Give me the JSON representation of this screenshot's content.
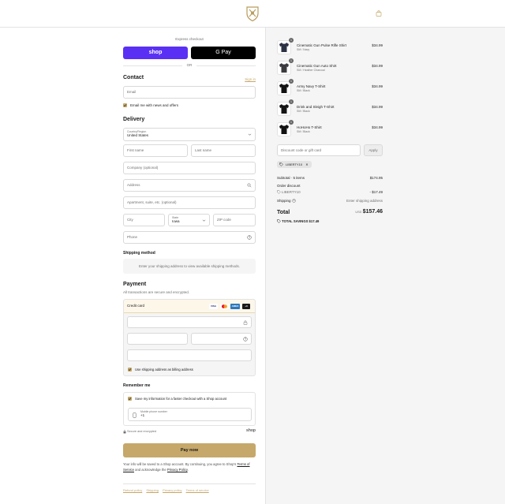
{
  "header": {
    "logo_icon": "shield-crest-icon",
    "cart_icon": "shopping-bag-icon"
  },
  "express": {
    "title": "Express checkout",
    "shop_label": "shop",
    "gpay_label": "G Pay",
    "or_label": "OR"
  },
  "contact": {
    "heading": "Contact",
    "sign_in": "Sign in",
    "email_placeholder": "Email",
    "news_label": "Email me with news and offers"
  },
  "delivery": {
    "heading": "Delivery",
    "country_label": "Country/Region",
    "country_value": "United States",
    "first_name": "First name",
    "last_name": "Last name",
    "company": "Company (optional)",
    "address": "Address",
    "apartment": "Apartment, suite, etc. (optional)",
    "city": "City",
    "state_label": "State",
    "state_value": "Iowa",
    "zip": "ZIP code",
    "phone": "Phone"
  },
  "shipping": {
    "heading": "Shipping method",
    "message": "Enter your shipping address to view available shipping methods."
  },
  "payment": {
    "heading": "Payment",
    "subtitle": "All transactions are secure and encrypted.",
    "method_label": "Credit card",
    "cards": [
      "VISA",
      "MC",
      "AMEX",
      "+3"
    ],
    "billing_label": "Use shipping address as billing address"
  },
  "remember": {
    "heading": "Remember me",
    "save_label": "Save my information for a faster checkout with a Shop account",
    "mobile_label": "Mobile phone number",
    "mobile_value": "+1",
    "secure_label": "Secure and encrypted",
    "shop_brand": "shop"
  },
  "pay_now_label": "Pay now",
  "footer": {
    "text_start": "Your info will be saved to a Shop account. By continuing, you agree to Shop's",
    "terms_link": "Terms of Service",
    "text_middle": "and acknowledge the",
    "privacy_link": "Privacy Policy",
    "text_end": ".",
    "links": [
      "Refund policy",
      "Shipping",
      "Privacy policy",
      "Terms of service"
    ]
  },
  "order": {
    "items": [
      {
        "name": "Cinematic Gun Pulse Rifle Shirt",
        "variant": "SM / Navy",
        "price": "$34.99",
        "qty": "1",
        "color": "#2c3244"
      },
      {
        "name": "Cinematic Gun Auto Shirt",
        "variant": "SM / Heather Charcoal",
        "price": "$34.99",
        "qty": "1",
        "color": "#3b3b3f"
      },
      {
        "name": "Army Navy T-Shirt",
        "variant": "SM / Black",
        "price": "$34.99",
        "qty": "1",
        "color": "#121212"
      },
      {
        "name": "Drink and Sleigh T-Shirt",
        "variant": "SM / Black",
        "price": "$34.99",
        "qty": "1",
        "color": "#141414"
      },
      {
        "name": "HoHoHo T-Shirt",
        "variant": "SM / Black",
        "price": "$34.99",
        "qty": "1",
        "color": "#111111"
      }
    ],
    "discount_placeholder": "Discount code or gift card",
    "apply_label": "Apply",
    "code": "LIBERTY10",
    "subtotal_label": "Subtotal · 5 items",
    "subtotal_value": "$174.95",
    "order_discount_label": "Order discount",
    "discount_code": "LIBERTY10",
    "discount_value": "- $17.49",
    "shipping_label": "Shipping",
    "shipping_value": "Enter shipping address",
    "total_label": "Total",
    "currency": "USD",
    "total_value": "$157.46",
    "savings_label": "TOTAL SAVINGS",
    "savings_value": "$17.49"
  },
  "colors": {
    "accent": "#c5a86a",
    "shop_purple": "#5a31f4",
    "panel_bg": "#f5f5f5"
  }
}
